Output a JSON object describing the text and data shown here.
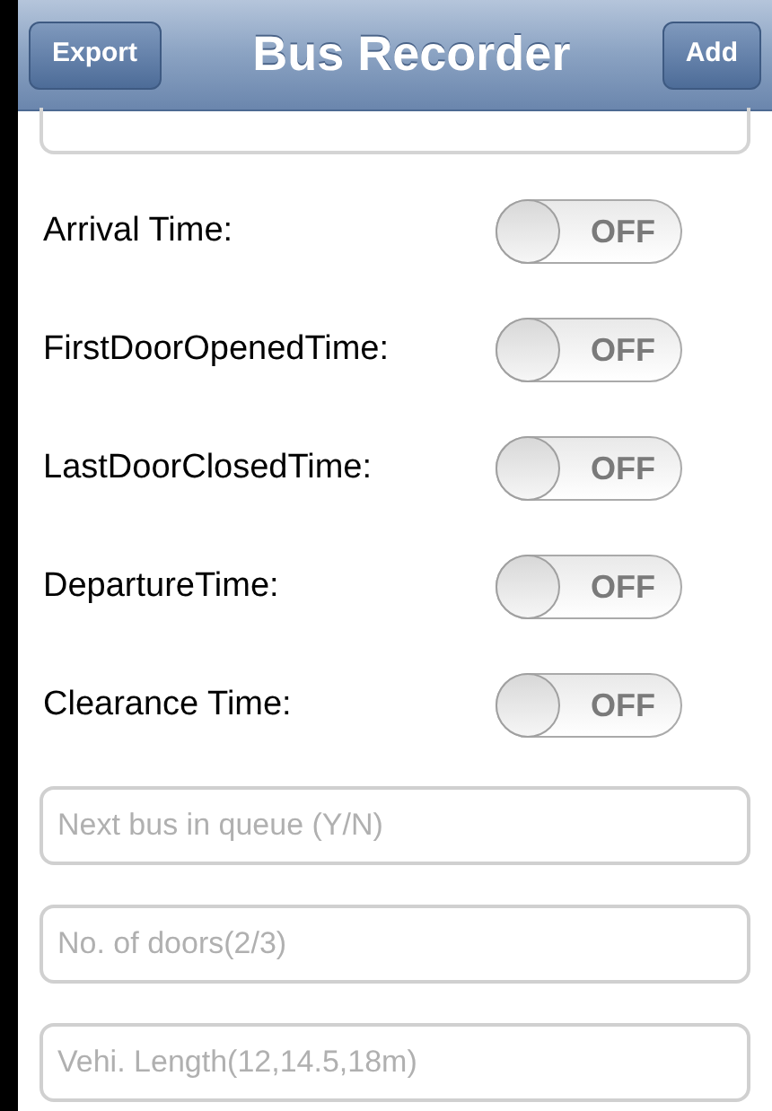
{
  "nav_bar": {
    "title": "Bus Recorder",
    "left_button": "Export",
    "right_button": "Add"
  },
  "toggles": [
    {
      "label": "Arrival Time:",
      "state_text": "OFF",
      "on": false
    },
    {
      "label": "FirstDoorOpenedTime:",
      "state_text": "OFF",
      "on": false
    },
    {
      "label": "LastDoorClosedTime:",
      "state_text": "OFF",
      "on": false
    },
    {
      "label": "DepartureTime:",
      "state_text": "OFF",
      "on": false
    },
    {
      "label": "Clearance Time:",
      "state_text": "OFF",
      "on": false
    }
  ],
  "fields": [
    {
      "placeholder": "Next bus in queue (Y/N)"
    },
    {
      "placeholder": "No. of doors(2/3)"
    },
    {
      "placeholder": "Vehi. Length(12,14.5,18m)"
    }
  ]
}
